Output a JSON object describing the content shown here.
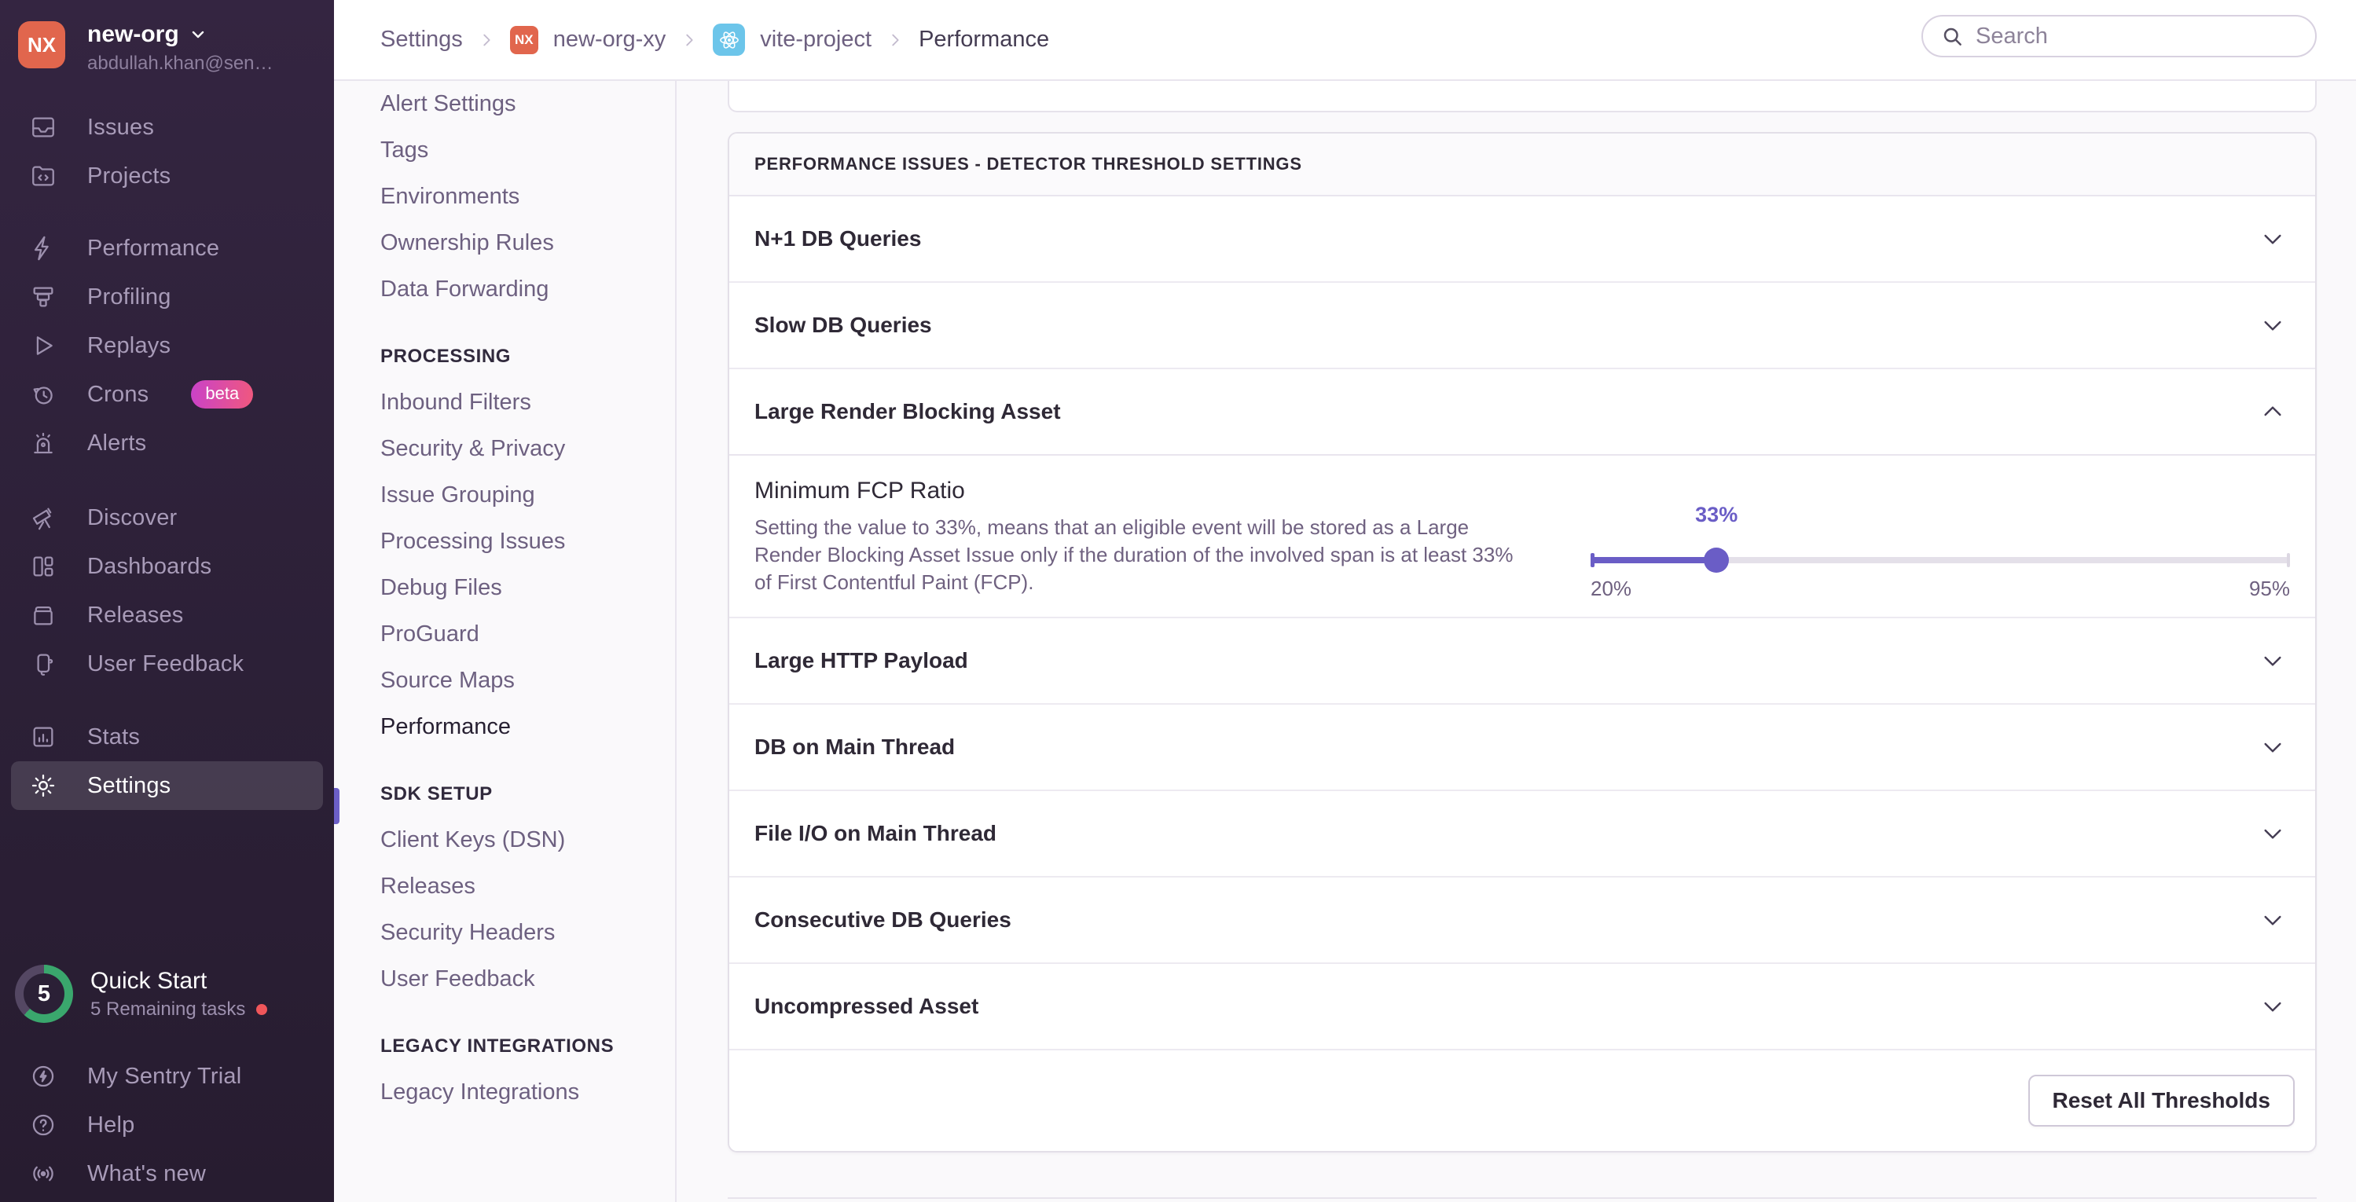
{
  "colors": {
    "accent": "#6c5fc7",
    "org_avatar": "#e1664d",
    "beta_gradient_from": "#c942c9",
    "beta_gradient_to": "#f0587e",
    "progress_ring": "#3aa76d",
    "notification_dot": "#f0565a",
    "project_badge_blue": "#6cc5ea"
  },
  "sidebar": {
    "org": {
      "initials": "NX",
      "name": "new-org",
      "email": "abdullah.khan@sen…"
    },
    "items": {
      "issues": "Issues",
      "projects": "Projects",
      "performance": "Performance",
      "profiling": "Profiling",
      "replays": "Replays",
      "crons": "Crons",
      "crons_badge": "beta",
      "alerts": "Alerts",
      "discover": "Discover",
      "dashboards": "Dashboards",
      "releases": "Releases",
      "user_feedback": "User Feedback",
      "stats": "Stats",
      "settings": "Settings"
    },
    "quickstart": {
      "count": "5",
      "title": "Quick Start",
      "subtitle": "5 Remaining tasks",
      "progress_percent": 62
    },
    "footer": {
      "trial": "My Sentry Trial",
      "help": "Help",
      "whats_new": "What's new"
    }
  },
  "topbar": {
    "breadcrumb": {
      "settings": "Settings",
      "org_badge": "NX",
      "org": "new-org-xy",
      "project": "vite-project",
      "page": "Performance"
    },
    "search_placeholder": "Search"
  },
  "settings_nav": {
    "top": [
      "Alert Settings",
      "Tags",
      "Environments",
      "Ownership Rules",
      "Data Forwarding"
    ],
    "processing_header": "PROCESSING",
    "processing": [
      "Inbound Filters",
      "Security & Privacy",
      "Issue Grouping",
      "Processing Issues",
      "Debug Files",
      "ProGuard",
      "Source Maps",
      "Performance"
    ],
    "sdk_header": "SDK SETUP",
    "sdk": [
      "Client Keys (DSN)",
      "Releases",
      "Security Headers",
      "User Feedback"
    ],
    "legacy_header": "LEGACY INTEGRATIONS",
    "legacy": [
      "Legacy Integrations"
    ]
  },
  "panel": {
    "title": "PERFORMANCE ISSUES - DETECTOR THRESHOLD SETTINGS",
    "rows": [
      "N+1 DB Queries",
      "Slow DB Queries",
      "Large Render Blocking Asset",
      "Large HTTP Payload",
      "DB on Main Thread",
      "File I/O on Main Thread",
      "Consecutive DB Queries",
      "Uncompressed Asset"
    ],
    "expanded": {
      "heading": "Minimum FCP Ratio",
      "description": "Setting the value to 33%, means that an eligible event will be stored as a Large Render Blocking Asset Issue only if the duration of the involved span is at least 33% of First Contentful Paint (FCP).",
      "slider": {
        "value": "33%",
        "min": "20%",
        "max": "95%",
        "fill_percent": 18
      }
    },
    "reset_button": "Reset All Thresholds"
  }
}
